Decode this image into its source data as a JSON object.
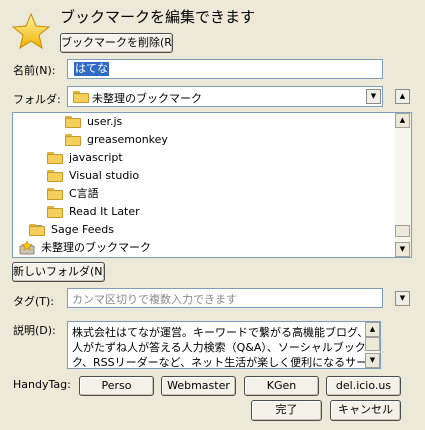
{
  "header": {
    "title": "ブックマークを編集できます",
    "delete_button": "ブックマークを削除(R)"
  },
  "name": {
    "label": "名前(N):",
    "value": "はてな"
  },
  "folder": {
    "label": "フォルダ:",
    "selected": "未整理のブックマーク",
    "expand_button": "▲"
  },
  "tree": {
    "items": [
      {
        "label": "user.js",
        "indent": 3
      },
      {
        "label": "greasemonkey",
        "indent": 3
      },
      {
        "label": "javascript",
        "indent": 2
      },
      {
        "label": "Visual studio",
        "indent": 2
      },
      {
        "label": "C言語",
        "indent": 2
      },
      {
        "label": "Read It Later",
        "indent": 2
      },
      {
        "label": "Sage Feeds",
        "indent": 1,
        "expander": "+"
      },
      {
        "label": "未整理のブックマーク",
        "indent": 1,
        "special": true
      }
    ]
  },
  "new_folder_button": "新しいフォルダ(N)",
  "tags": {
    "label": "タグ(T):",
    "placeholder": "カンマ区切りで複数入力できます"
  },
  "description": {
    "label": "説明(D):",
    "lines": [
      "株式会社はてなが運営。キーワードで繋がる高機能ブログ、",
      "人がたずね人が答える人力検索（Q&A）、ソーシャルブックマー",
      "ク、RSSリーダーなど、ネット生活が楽しく便利になるサービスが"
    ]
  },
  "handytag": {
    "label": "HandyTag:",
    "tags": [
      "Perso",
      "Webmaster",
      "KGen",
      "del.icio.us"
    ]
  },
  "footer": {
    "done": "完了",
    "cancel": "キャンセル"
  },
  "icons": {
    "star": "star-icon",
    "folder": "folder-icon",
    "bookmark_folder": "unsorted-bookmarks-icon"
  },
  "colors": {
    "background": "#ece9d8",
    "selection": "#316ac5",
    "folder": "#f5cf5b",
    "star": "#f7c51c"
  }
}
